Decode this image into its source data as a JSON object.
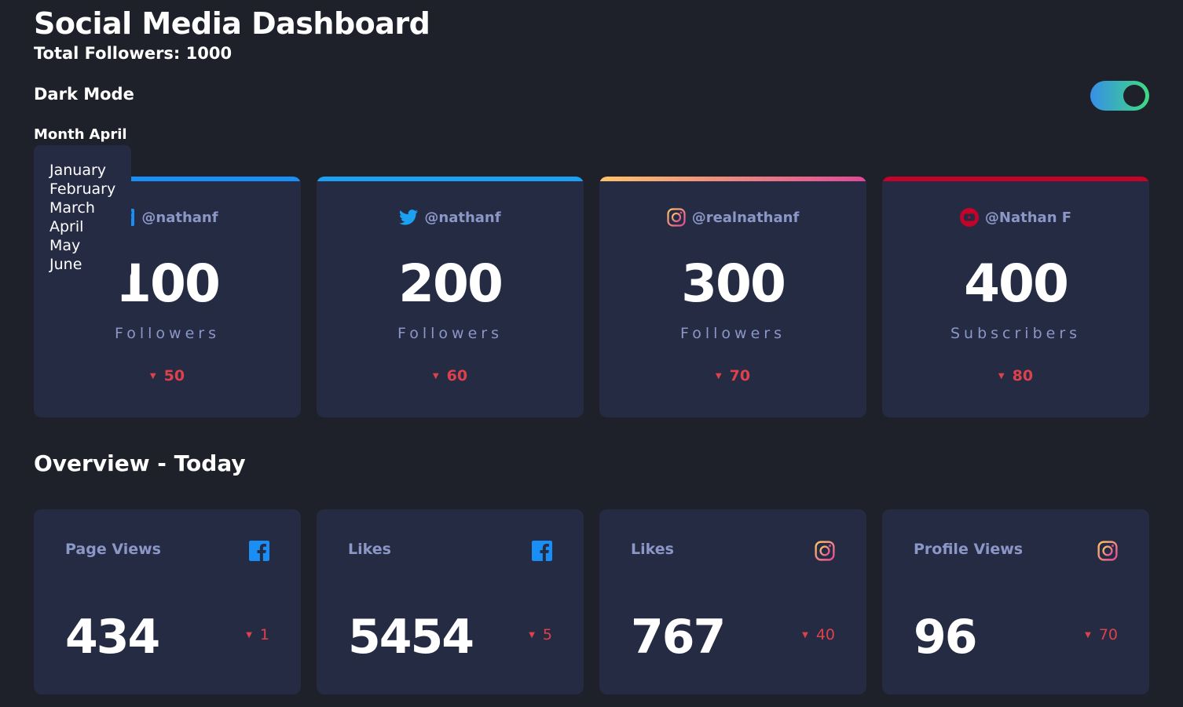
{
  "header": {
    "title": "Social Media Dashboard",
    "total_followers": "Total Followers: 1000",
    "dark_mode_label": "Dark Mode",
    "dark_mode_on": true
  },
  "month": {
    "label": "Month",
    "selected": "April",
    "options": [
      "January",
      "February",
      "March",
      "April",
      "May",
      "June"
    ]
  },
  "cards": [
    {
      "platform": "facebook",
      "icon": "facebook-icon",
      "handle": "@nathanf",
      "count": "100",
      "unit": "Followers",
      "change": "50",
      "bar_color": "#198ff5"
    },
    {
      "platform": "twitter",
      "icon": "twitter-icon",
      "handle": "@nathanf",
      "count": "200",
      "unit": "Followers",
      "change": "60",
      "bar_color": "#1ca0f2"
    },
    {
      "platform": "instagram",
      "icon": "instagram-icon",
      "handle": "@realnathanf",
      "count": "300",
      "unit": "Followers",
      "change": "70",
      "bar_color": "linear-gradient(90deg,#fdc468,#df4996)"
    },
    {
      "platform": "youtube",
      "icon": "youtube-icon",
      "handle": "@Nathan F",
      "count": "400",
      "unit": "Subscribers",
      "change": "80",
      "bar_color": "#c4032a"
    }
  ],
  "overview": {
    "title": "Overview - Today",
    "items": [
      {
        "label": "Page Views",
        "icon": "facebook-icon",
        "value": "434",
        "delta": "1"
      },
      {
        "label": "Likes",
        "icon": "facebook-icon",
        "value": "5454",
        "delta": "5"
      },
      {
        "label": "Likes",
        "icon": "instagram-icon",
        "value": "767",
        "delta": "40"
      },
      {
        "label": "Profile Views",
        "icon": "instagram-icon",
        "value": "96",
        "delta": "70"
      }
    ]
  },
  "colors": {
    "background": "#1e202a",
    "card": "#252b43",
    "muted_text": "#8b97c6",
    "down": "#dc414c",
    "toggle_start": "#378fe6",
    "toggle_end": "#3eda82"
  }
}
